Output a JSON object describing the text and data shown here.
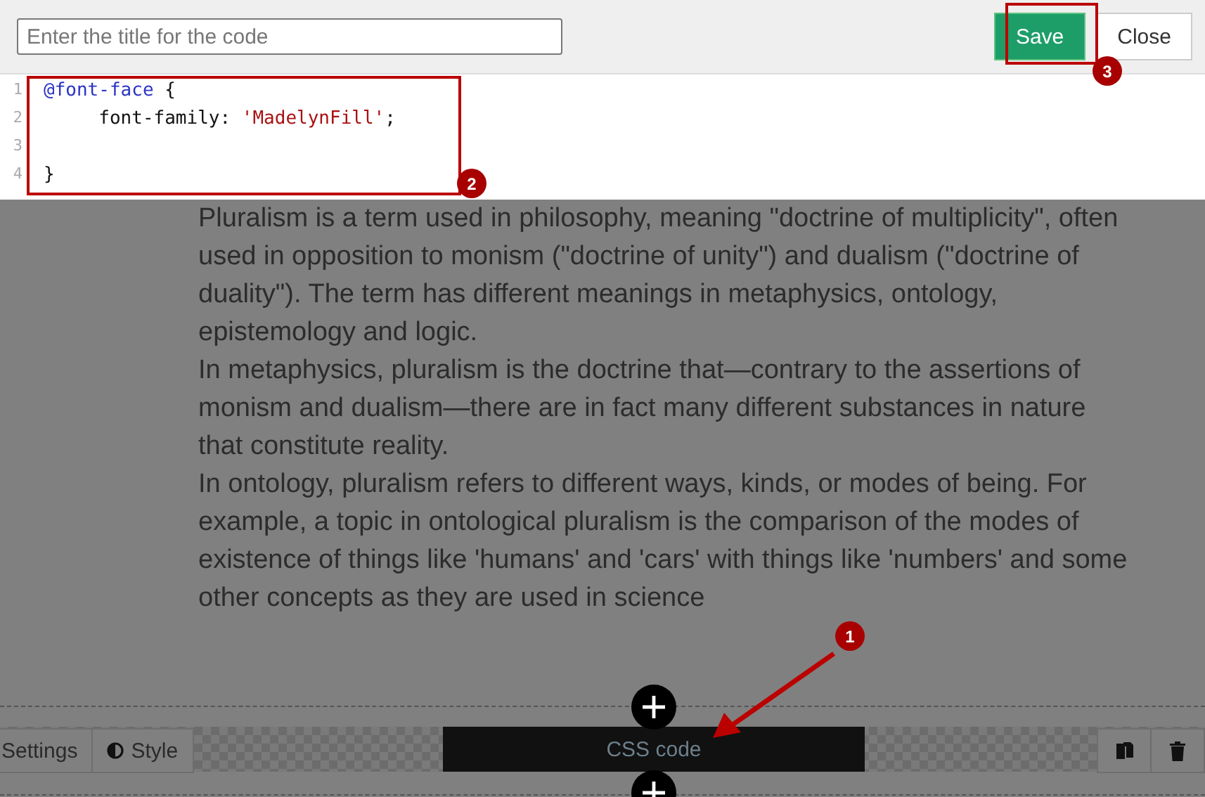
{
  "title_field": {
    "placeholder": "Enter the title for the code"
  },
  "buttons": [
    {
      "label": "Save",
      "kind": "primary"
    },
    {
      "label": "Close",
      "kind": "secondary"
    }
  ],
  "code_lines": [
    {
      "number": "1",
      "tokens": [
        {
          "text": "@font-face",
          "kind": "keyword"
        },
        {
          "text": " {",
          "kind": "plain"
        }
      ]
    },
    {
      "number": "2",
      "tokens": [
        {
          "text": "     font-family: ",
          "kind": "plain"
        },
        {
          "text": "'MadelynFill'",
          "kind": "string"
        },
        {
          "text": ";",
          "kind": "plain"
        }
      ]
    },
    {
      "number": "3"
    },
    {
      "number": "4",
      "tokens": [
        {
          "text": "}",
          "kind": "plain"
        }
      ]
    }
  ],
  "content_lines": [
    "Pluralism is a term used in philosophy, meaning \"doctrine of multiplicity\", often",
    "used in opposition to monism (\"doctrine of unity\") and dualism (\"doctrine of",
    "duality\"). The term has different meanings in metaphysics, ontology,",
    "epistemology and logic.",
    "In metaphysics, pluralism is the doctrine that—contrary to the assertions of",
    "monism and dualism—there are in fact many different substances in nature",
    "that constitute reality.",
    "In ontology, pluralism refers to different ways, kinds, or modes of being. For",
    "example, a topic in ontological pluralism is the comparison of the modes of",
    "existence of things like 'humans' and 'cars' with things like 'numbers' and some",
    "other concepts as they are used in science"
  ],
  "block_toolbar": {
    "settings": "Settings",
    "style": "Style",
    "block_label": "CSS code"
  },
  "annotations": [
    {
      "number": "1"
    },
    {
      "number": "2"
    },
    {
      "number": "3"
    }
  ]
}
